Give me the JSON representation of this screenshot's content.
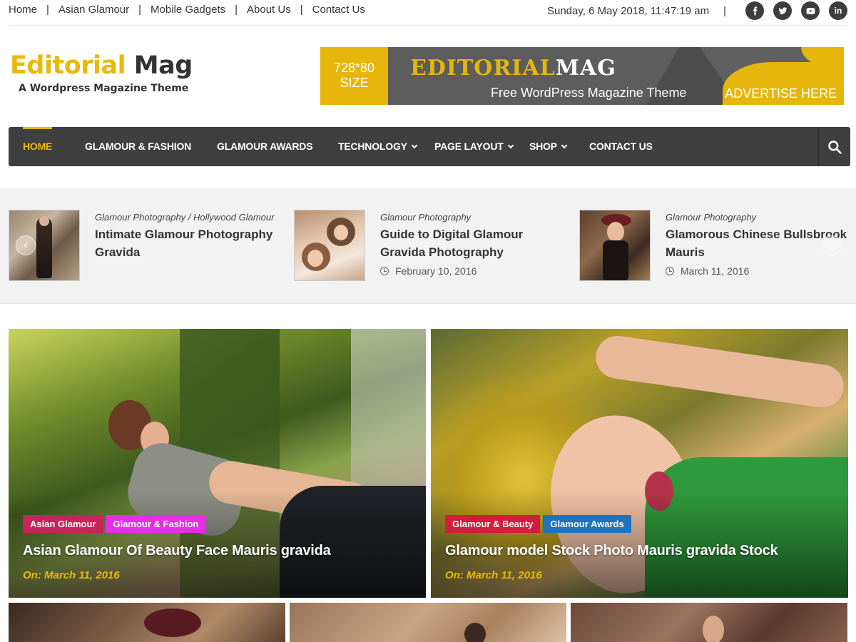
{
  "topbar": {
    "links": [
      "Home",
      "Asian Glamour",
      "Mobile Gadgets",
      "About Us",
      "Contact Us"
    ],
    "separator": "|",
    "datetime": "Sunday, 6 May 2018, 11:47:19 am",
    "social": [
      "facebook-icon",
      "twitter-icon",
      "youtube-icon",
      "linkedin-icon"
    ],
    "linkedin_text": "in"
  },
  "logo": {
    "word1": "Editorial",
    "word2": "Mag",
    "tagline": "A Wordpress Magazine Theme"
  },
  "banner": {
    "size_line1": "728*80",
    "size_line2": "SIZE",
    "title_a": "EDITORIAL",
    "title_b": "MAG",
    "subtitle": "Free WordPress Magazine Theme",
    "cta": "ADVERTISE HERE"
  },
  "nav": {
    "items": [
      "HOME",
      "GLAMOUR & FASHION",
      "GLAMOUR AWARDS",
      "TECHNOLOGY",
      "PAGE LAYOUT",
      "SHOP",
      "CONTACT US"
    ]
  },
  "ticker": {
    "items": [
      {
        "category": "Glamour Photography / Hollywood Glamour",
        "title": "Intimate Glamour Photography Gravida",
        "date": ""
      },
      {
        "category": "Glamour Photography",
        "title": "Guide to Digital Glamour Gravida Photography",
        "date": "February 10, 2016"
      },
      {
        "category": "Glamour Photography",
        "title": "Glamorous Chinese Bullsbrook Mauris",
        "date": "March 11, 2016"
      }
    ]
  },
  "featured": [
    {
      "tags": [
        {
          "label": "Asian Glamour",
          "color": "#c8235a"
        },
        {
          "label": "Glamour & Fashion",
          "color": "#e62ee6"
        }
      ],
      "title": "Asian Glamour Of Beauty Face Mauris gravida",
      "date": "On: March 11, 2016"
    },
    {
      "tags": [
        {
          "label": "Glamour & Beauty",
          "color": "#d01e3c"
        },
        {
          "label": "Glamour Awards",
          "color": "#1e73be"
        }
      ],
      "title": "Glamour model Stock Photo Mauris gravida Stock",
      "date": "On: March 11, 2016"
    }
  ],
  "colors": {
    "accent": "#e8b80c",
    "nav_bg": "#3f3f3f",
    "ticker_bg": "#f2f2f2"
  }
}
